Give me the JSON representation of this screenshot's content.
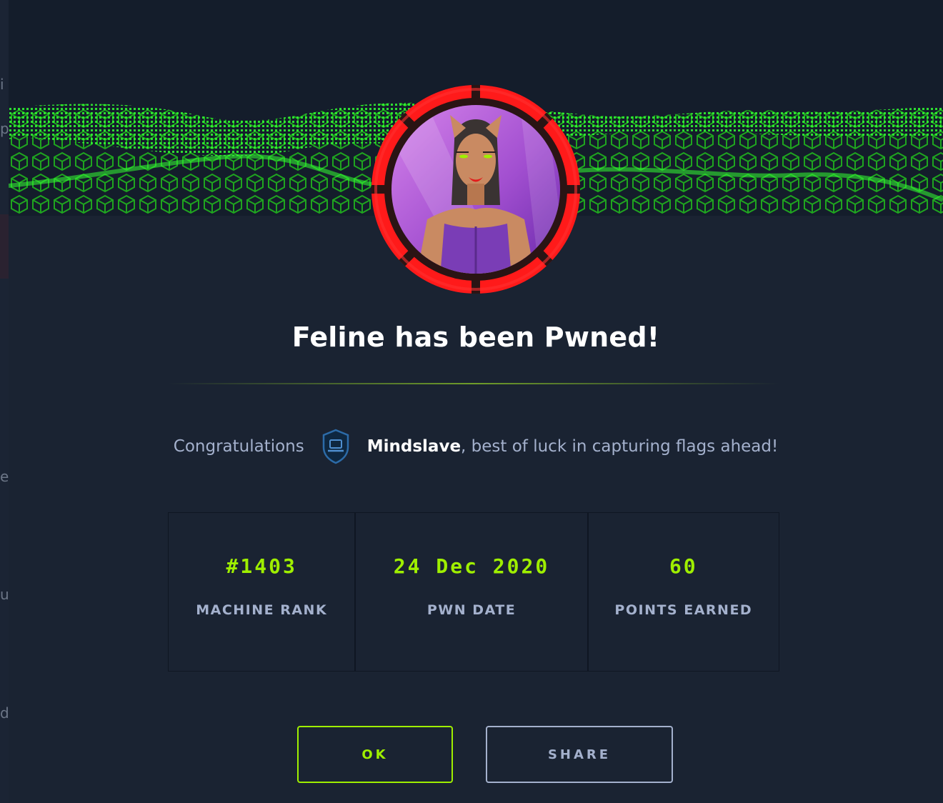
{
  "background": {
    "glyphs": [
      "i",
      "p",
      "e",
      "u",
      "d"
    ]
  },
  "modal": {
    "machine_avatar": "feline-machine-avatar",
    "title": "Feline has been Pwned!",
    "congrats": {
      "prefix": "Congratulations",
      "rank_icon": "shield-laptop-icon",
      "username": "Mindslave",
      "suffix": ", best of luck in capturing flags ahead!"
    },
    "stats": [
      {
        "value": "#1403",
        "label": "MACHINE RANK"
      },
      {
        "value": "24 Dec 2020",
        "label": "PWN DATE"
      },
      {
        "value": "60",
        "label": "POINTS EARNED"
      }
    ],
    "buttons": {
      "ok": "OK",
      "share": "SHARE"
    }
  },
  "colors": {
    "accent_green": "#9fef00",
    "difficulty_ring": "#e60c0c",
    "background": "#1a2332"
  }
}
